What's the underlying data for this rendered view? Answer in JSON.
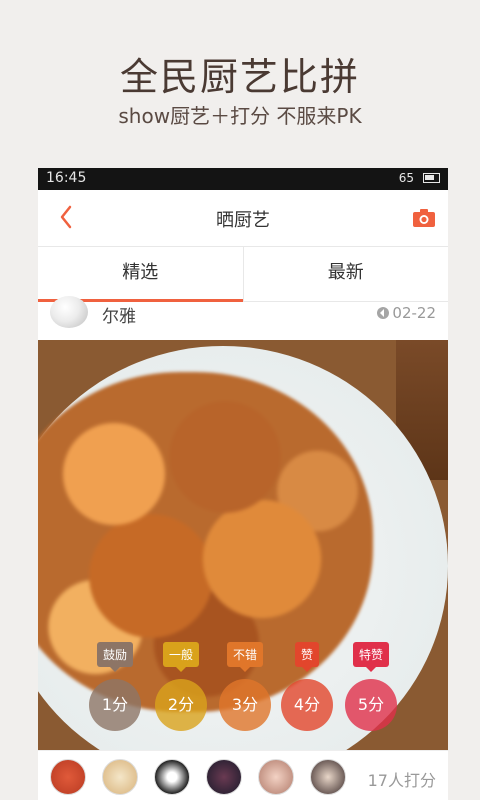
{
  "promo": {
    "title": "全民厨艺比拼",
    "subtitle": "show厨艺＋打分 不服来PK"
  },
  "status_bar": {
    "time": "16:45",
    "battery": "65"
  },
  "nav": {
    "title": "晒厨艺",
    "back_icon": "chevron-left-icon",
    "camera_icon": "camera-icon",
    "accent": "#f0613f"
  },
  "tabs": [
    {
      "label": "精选",
      "active": true
    },
    {
      "label": "最新",
      "active": false
    }
  ],
  "post": {
    "username": "尔雅",
    "date": "02-22",
    "date_icon": "chevron-left-circle-icon"
  },
  "ratings": [
    {
      "tag": "鼓励",
      "score": "1分",
      "color": "#8d7566"
    },
    {
      "tag": "一般",
      "score": "2分",
      "color": "#d9a21b"
    },
    {
      "tag": "不错",
      "score": "3分",
      "color": "#e0762a"
    },
    {
      "tag": "赞",
      "score": "4分",
      "color": "#e2462c"
    },
    {
      "tag": "特赞",
      "score": "5分",
      "color": "#e0304a"
    }
  ],
  "raters": {
    "count_text": "17人打分"
  }
}
